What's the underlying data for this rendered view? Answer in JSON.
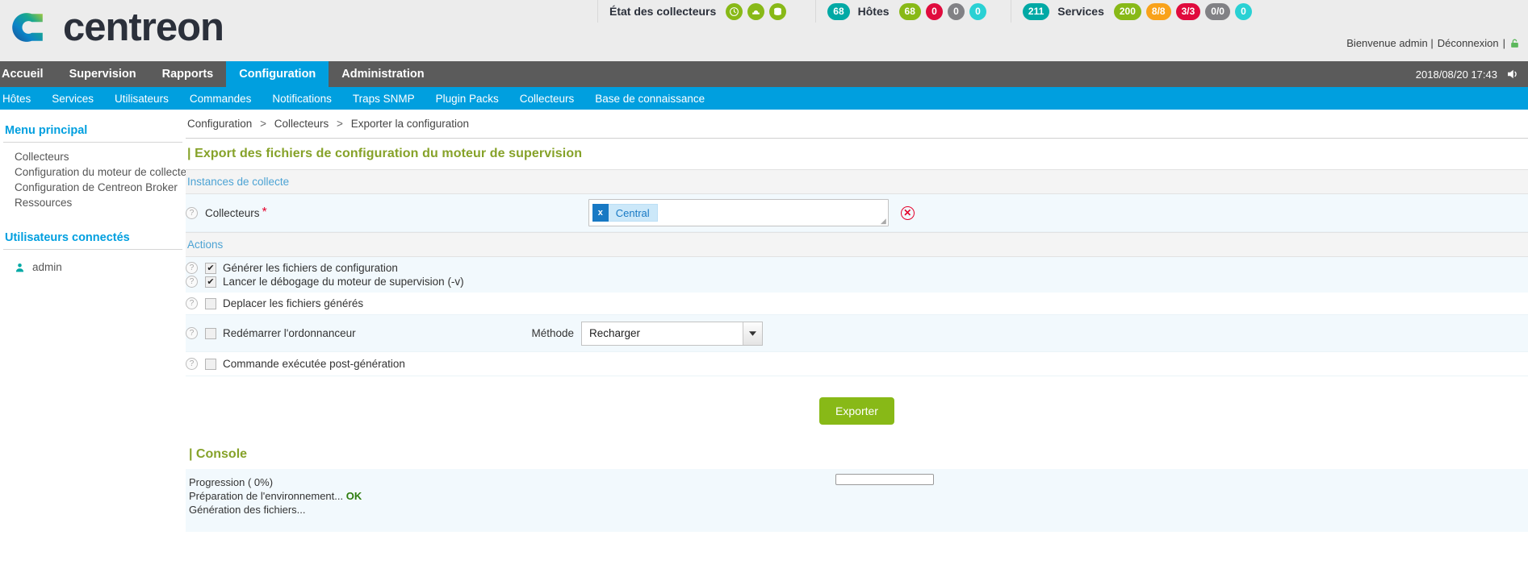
{
  "header": {
    "brand": "centreon",
    "collectors_status_label": "État des collecteurs",
    "collector_icons": [
      {
        "name": "clock-icon",
        "glyph": "◔"
      },
      {
        "name": "engine-icon",
        "glyph": "⬒"
      },
      {
        "name": "database-icon",
        "glyph": "⛁"
      }
    ],
    "hosts": {
      "total": "68",
      "name": "Hôtes",
      "counts": [
        {
          "value": "68",
          "state": "up"
        },
        {
          "value": "0",
          "state": "down"
        },
        {
          "value": "0",
          "state": "unreachable"
        },
        {
          "value": "0",
          "state": "pending"
        }
      ]
    },
    "services": {
      "total": "211",
      "name": "Services",
      "counts": [
        {
          "value": "200",
          "state": "ok"
        },
        {
          "value": "8/8",
          "state": "warning"
        },
        {
          "value": "3/3",
          "state": "critical"
        },
        {
          "value": "0/0",
          "state": "unknown"
        },
        {
          "value": "0",
          "state": "pending"
        }
      ]
    },
    "welcome_text": "Bienvenue admin |",
    "logout_label": "Déconnexion",
    "welcome_tail": "|",
    "timestamp": "2018/08/20 17:43"
  },
  "main_nav": {
    "items": [
      {
        "label": "Accueil",
        "active": false
      },
      {
        "label": "Supervision",
        "active": false
      },
      {
        "label": "Rapports",
        "active": false
      },
      {
        "label": "Configuration",
        "active": true
      },
      {
        "label": "Administration",
        "active": false
      }
    ]
  },
  "sub_nav": {
    "items": [
      {
        "label": "Hôtes"
      },
      {
        "label": "Services"
      },
      {
        "label": "Utilisateurs"
      },
      {
        "label": "Commandes"
      },
      {
        "label": "Notifications"
      },
      {
        "label": "Traps SNMP"
      },
      {
        "label": "Plugin Packs"
      },
      {
        "label": "Collecteurs"
      },
      {
        "label": "Base de connaissance"
      }
    ]
  },
  "sidebar": {
    "main_menu_title": "Menu principal",
    "items": [
      {
        "label": "Collecteurs"
      },
      {
        "label": "Configuration du moteur de collecte"
      },
      {
        "label": "Configuration de Centreon Broker"
      },
      {
        "label": "Ressources"
      }
    ],
    "connected_users_title": "Utilisateurs connectés",
    "users": [
      {
        "label": "admin"
      }
    ]
  },
  "breadcrumb": {
    "items": [
      "Configuration",
      "Collecteurs",
      "Exporter la configuration"
    ],
    "separator": ">"
  },
  "page": {
    "title": "| Export des fichiers de configuration du moteur de supervision",
    "instances_section": "Instances de collecte",
    "collectors_field": {
      "label": "Collecteurs",
      "required_mark": "*",
      "tags": [
        {
          "label": "Central",
          "remove": "x"
        }
      ],
      "clear_glyph": "✕"
    },
    "actions_section": "Actions",
    "actions": [
      {
        "label": "Générer les fichiers de configuration",
        "checked": true
      },
      {
        "label": "Lancer le débogage du moteur de supervision (-v)",
        "checked": true
      },
      {
        "label": "Deplacer les fichiers générés",
        "checked": false
      },
      {
        "label": "Redémarrer l'ordonnanceur",
        "checked": false
      },
      {
        "label": "Commande exécutée post-génération",
        "checked": false
      }
    ],
    "method": {
      "label": "Méthode",
      "value": "Recharger",
      "arrow": "▼"
    },
    "export_button": "Exporter"
  },
  "console": {
    "title": "| Console",
    "lines": [
      {
        "text": "Progression ( 0%)",
        "status": ""
      },
      {
        "text": "Préparation de l'environnement...",
        "status": "OK"
      },
      {
        "text": "Génération des fichiers...",
        "status": ""
      }
    ],
    "progress_percent": "0"
  },
  "colors": {
    "brand_blue": "#009fdf",
    "olive": "#86a229",
    "green": "#88b917",
    "teal": "#00a9a5",
    "red": "#e00b3d",
    "orange": "#f9a21a",
    "gray": "#818185",
    "cyan": "#2ad1d4"
  }
}
